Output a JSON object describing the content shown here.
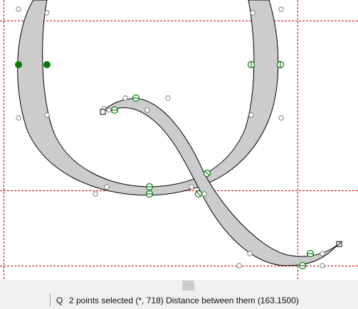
{
  "status": {
    "glyph": "Q",
    "message": "2 points selected (*, 718) Distance between them (163.1500)"
  },
  "colors": {
    "fill": "#cccccc",
    "guide": "#cc0000",
    "selected_point": "#0a7a0a",
    "control_point": "#808080"
  }
}
